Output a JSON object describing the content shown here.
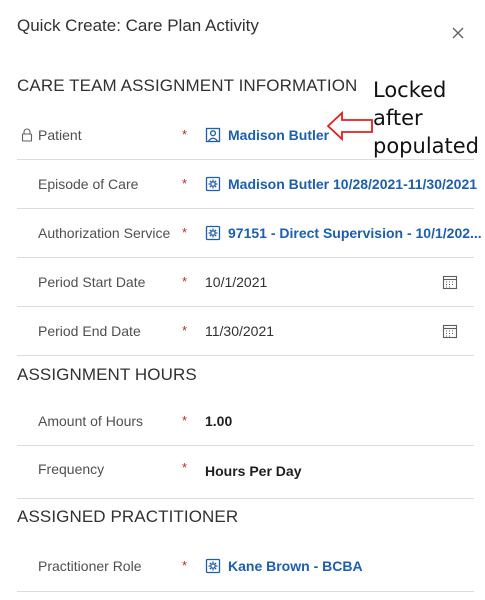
{
  "dialog": {
    "title": "Quick Create: Care Plan Activity"
  },
  "sections": {
    "care_team": "CARE TEAM ASSIGNMENT INFORMATION",
    "hours": "ASSIGNMENT HOURS",
    "practitioner": "ASSIGNED PRACTITIONER"
  },
  "fields": {
    "patient": {
      "label": "Patient",
      "required": "*",
      "value": "Madison Butler",
      "locked": true
    },
    "episode": {
      "label": "Episode of Care",
      "required": "*",
      "value": "Madison Butler 10/28/2021-11/30/2021"
    },
    "authorization": {
      "label": "Authorization Service",
      "required": "*",
      "value": "97151 - Direct Supervision - 10/1/202..."
    },
    "period_start": {
      "label": "Period Start Date",
      "required": "*",
      "value": "10/1/2021"
    },
    "period_end": {
      "label": "Period End Date",
      "required": "*",
      "value": "11/30/2021"
    },
    "amount": {
      "label": "Amount of Hours",
      "required": "*",
      "value": "1.00"
    },
    "frequency": {
      "label": "Frequency",
      "required": "*",
      "value": "Hours Per Day"
    },
    "role": {
      "label": "Practitioner Role",
      "required": "*",
      "value": "Kane Brown - BCBA"
    }
  },
  "annotation": {
    "line1": "Locked",
    "line2": "after",
    "line3": "populated"
  },
  "icons": {
    "close": "close-icon",
    "lock": "lock-icon",
    "contact": "contact-icon",
    "entity": "entity-record-icon",
    "calendar": "calendar-icon"
  },
  "colors": {
    "link": "#1b5fae",
    "required": "#c4262e",
    "divider": "#dcdcdc",
    "annotation_arrow": "#e0201b"
  }
}
